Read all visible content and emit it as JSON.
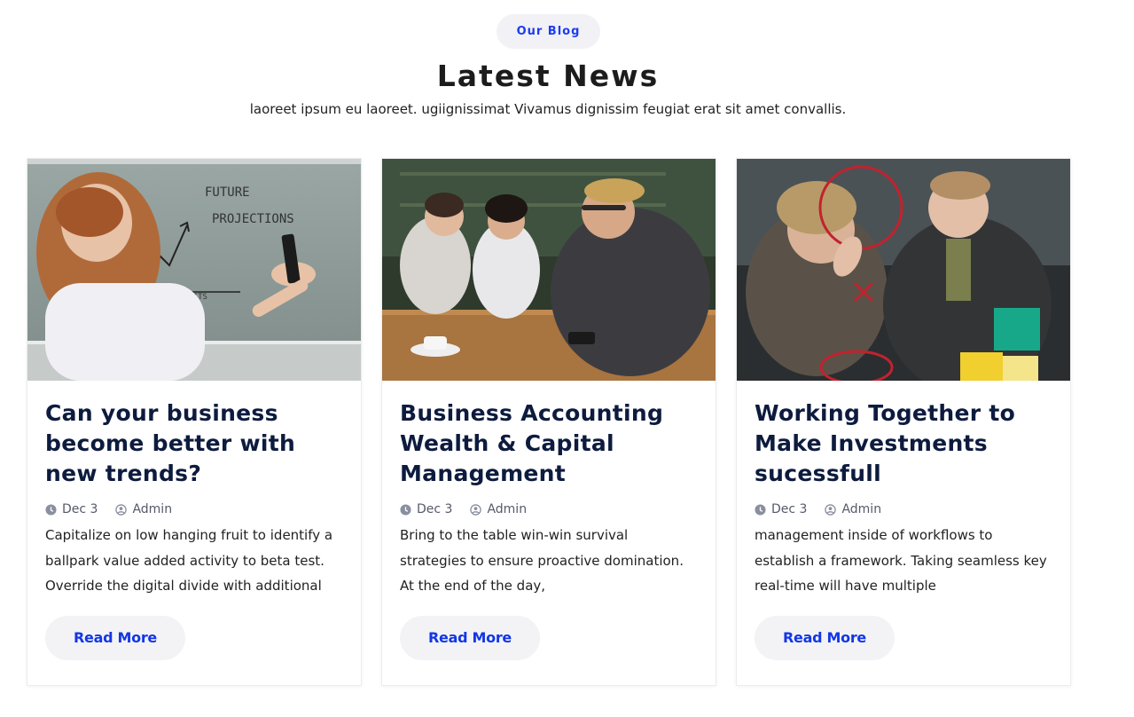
{
  "header": {
    "eyebrow": "Our Blog",
    "title": "Latest News",
    "subtitle": "laoreet ipsum eu laoreet. ugiignissimat Vivamus dignissim feugiat erat sit amet convallis."
  },
  "cards": [
    {
      "title": "Can your business become better with new trends?",
      "date": "Dec 3",
      "author": "Admin",
      "excerpt": "Capitalize on low hanging fruit to identify a ballpark value added activity to beta test. Override the digital divide with additional",
      "button": "Read More",
      "image_annotations": [
        "FUTURE",
        "PROJECTIONS",
        "PROFITS"
      ]
    },
    {
      "title": "Business Accounting Wealth & Capital Management",
      "date": "Dec 3",
      "author": "Admin",
      "excerpt": "Bring to the table win-win survival strategies to ensure proactive domination. At the end of the day,",
      "button": "Read More"
    },
    {
      "title": "Working Together to Make Investments sucessfull",
      "date": "Dec 3",
      "author": "Admin",
      "excerpt": "management inside of workflows to establish a framework. Taking seamless key real-time will have multiple",
      "button": "Read More"
    }
  ],
  "colors": {
    "accent": "#1237e6",
    "heading": "#0d1b3e",
    "pill_bg": "#f2f2f6"
  },
  "icons": {
    "date": "clock-icon",
    "author": "user-circle-icon"
  }
}
